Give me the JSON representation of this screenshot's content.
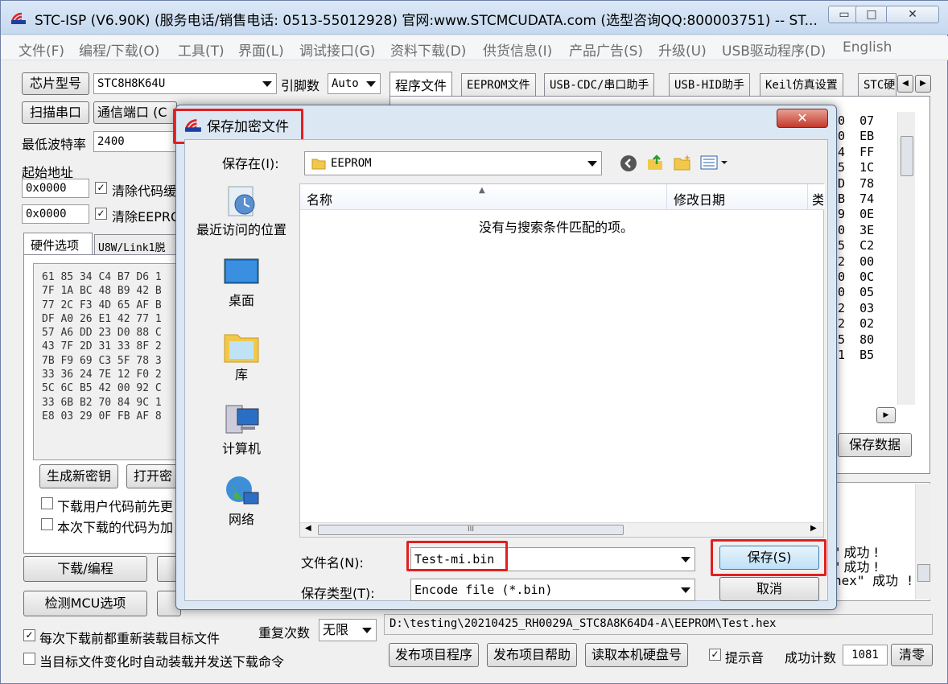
{
  "app": {
    "title": "STC-ISP (V6.90K) (服务电话/销售电话: 0513-55012928) 官网:www.STCMCUDATA.com  (选型咨询QQ:800003751) -- ST...",
    "window_buttons": {
      "minimize": "▭",
      "maximize": "□",
      "close": "✕"
    }
  },
  "menu": [
    "文件(F)",
    "编程/下载(O)",
    "工具(T)",
    "界面(L)",
    "调试接口(G)",
    "资料下载(D)",
    "供货信息(I)",
    "产品广告(S)",
    "升级(U)",
    "USB驱动程序(D)",
    "English"
  ],
  "left": {
    "chip_label": "芯片型号",
    "chip_value": "STC8H8K64U",
    "pin_label": "引脚数",
    "pin_value": "Auto",
    "scan_label": "扫描串口",
    "port_label": "通信端口",
    "port_value": "(C",
    "baud_label": "最低波特率",
    "baud_value": "2400",
    "start_addr_label": "起始地址",
    "addr1": "0x0000",
    "clear_code_label": "清除代码缓",
    "addr2": "0x0000",
    "clear_eeprom_label": "清除EEPRO",
    "hw_tab": "硬件选项",
    "u8w_tab": "U8W/Link1脱",
    "hex_lines": [
      "61 85 34 C4 B7 D6 1",
      "7F 1A BC 48 B9 42 B",
      "77 2C F3 4D 65 AF B",
      "DF A0 26 E1 42 77 1",
      "57 A6 DD 23 D0 88 C",
      "43 7F 2D 31 33 8F 2",
      "7B F9 69 C3 5F 78 3",
      "33 36 24 7E 12 F0 2",
      "5C 6C B5 42 00 92 C",
      "33 6B B2 70 84 9C 1",
      "E8 03 29 0F FB AF 8"
    ],
    "gen_key_btn": "生成新密钥",
    "open_key_btn": "打开密",
    "opt1_label": "下载用户代码前先更",
    "opt2_label": "本次下载的代码为加",
    "download_btn": "下载/编程",
    "detect_btn": "检测MCU选项",
    "reload_label": "每次下载前都重新装载目标文件",
    "auto_label": "当目标文件变化时自动装载并发送下载命令",
    "repeat_label": "重复次数",
    "repeat_value": "无限"
  },
  "right": {
    "tabs": [
      "程序文件",
      "EEPROM文件",
      "USB-CDC/串口助手",
      "USB-HID助手",
      "Keil仿真设置",
      "STC硬"
    ],
    "hex_col": [
      "0  07",
      "0  EB",
      "4  FF",
      "5  1C",
      "D  78",
      "B  74",
      "9  0E",
      "0  3E",
      "5  C2",
      "2  00",
      "0  0C",
      "0  05",
      "2  03",
      "2  02",
      "5  80",
      "1  B5"
    ],
    "save_data_btn": "保存数据",
    "log_lines": [
      "\" 成功 !",
      "\" 成功 !",
      "hex\" 成功 !"
    ],
    "path": "D:\\testing\\20210425_RH0029A_STC8A8K64D4-A\\EEPROM\\Test.hex",
    "publish_btn": "发布项目程序",
    "publish_help_btn": "发布项目帮助",
    "read_disk_btn": "读取本机硬盘号",
    "sound_label": "提示音",
    "success_count_label": "成功计数",
    "success_count": "1081",
    "clear_btn": "清零"
  },
  "dialog": {
    "title": "保存加密文件",
    "close": "✕",
    "save_in_label": "保存在(I):",
    "save_in_value": "EEPROM",
    "sidebar": [
      "最近访问的位置",
      "桌面",
      "库",
      "计算机",
      "网络"
    ],
    "col_name": "名称",
    "col_date": "修改日期",
    "col_type": "类",
    "empty_msg": "没有与搜索条件匹配的项。",
    "scroll_grip": "III",
    "filename_label": "文件名(N):",
    "filename_value": "Test-mi.bin",
    "filetype_label": "保存类型(T):",
    "filetype_value": "Encode file (*.bin)",
    "save_btn": "保存(S)",
    "cancel_btn": "取消"
  }
}
